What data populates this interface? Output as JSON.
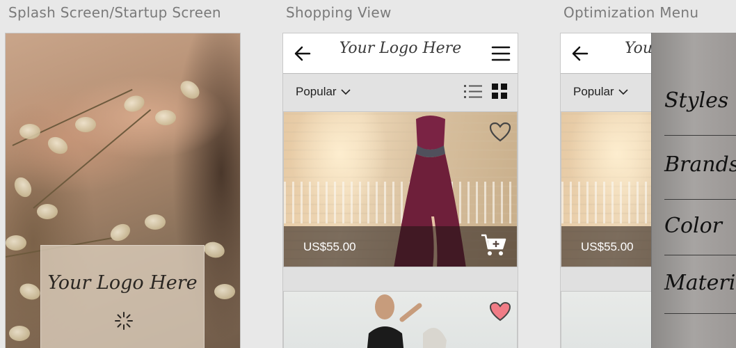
{
  "columns": {
    "splash_title": "Splash Screen/Startup Screen",
    "shopping_title": "Shopping View",
    "optimization_title": "Optimization Menu"
  },
  "splash": {
    "logo_text": "Your Logo Here"
  },
  "shopping": {
    "header": {
      "logo_text": "Your Logo Here"
    },
    "filter": {
      "sort_label": "Popular"
    },
    "products": [
      {
        "price": "US$55.00",
        "favorited": false
      },
      {
        "favorited": true
      }
    ]
  },
  "optimization": {
    "header": {
      "logo_text": "Your"
    },
    "filter": {
      "sort_label": "Popular"
    },
    "products": [
      {
        "price": "US$55.00"
      }
    ],
    "menu_items": [
      "Styles",
      "Brands",
      "Color",
      "Material"
    ]
  },
  "colors": {
    "heart_filled": "#f07c86",
    "dress": "#6e1f3a"
  },
  "icons": [
    "back-arrow-icon",
    "hamburger-menu-icon",
    "chevron-down-icon",
    "list-view-icon",
    "grid-view-icon",
    "heart-icon",
    "add-to-cart-icon",
    "loading-spinner-icon"
  ]
}
